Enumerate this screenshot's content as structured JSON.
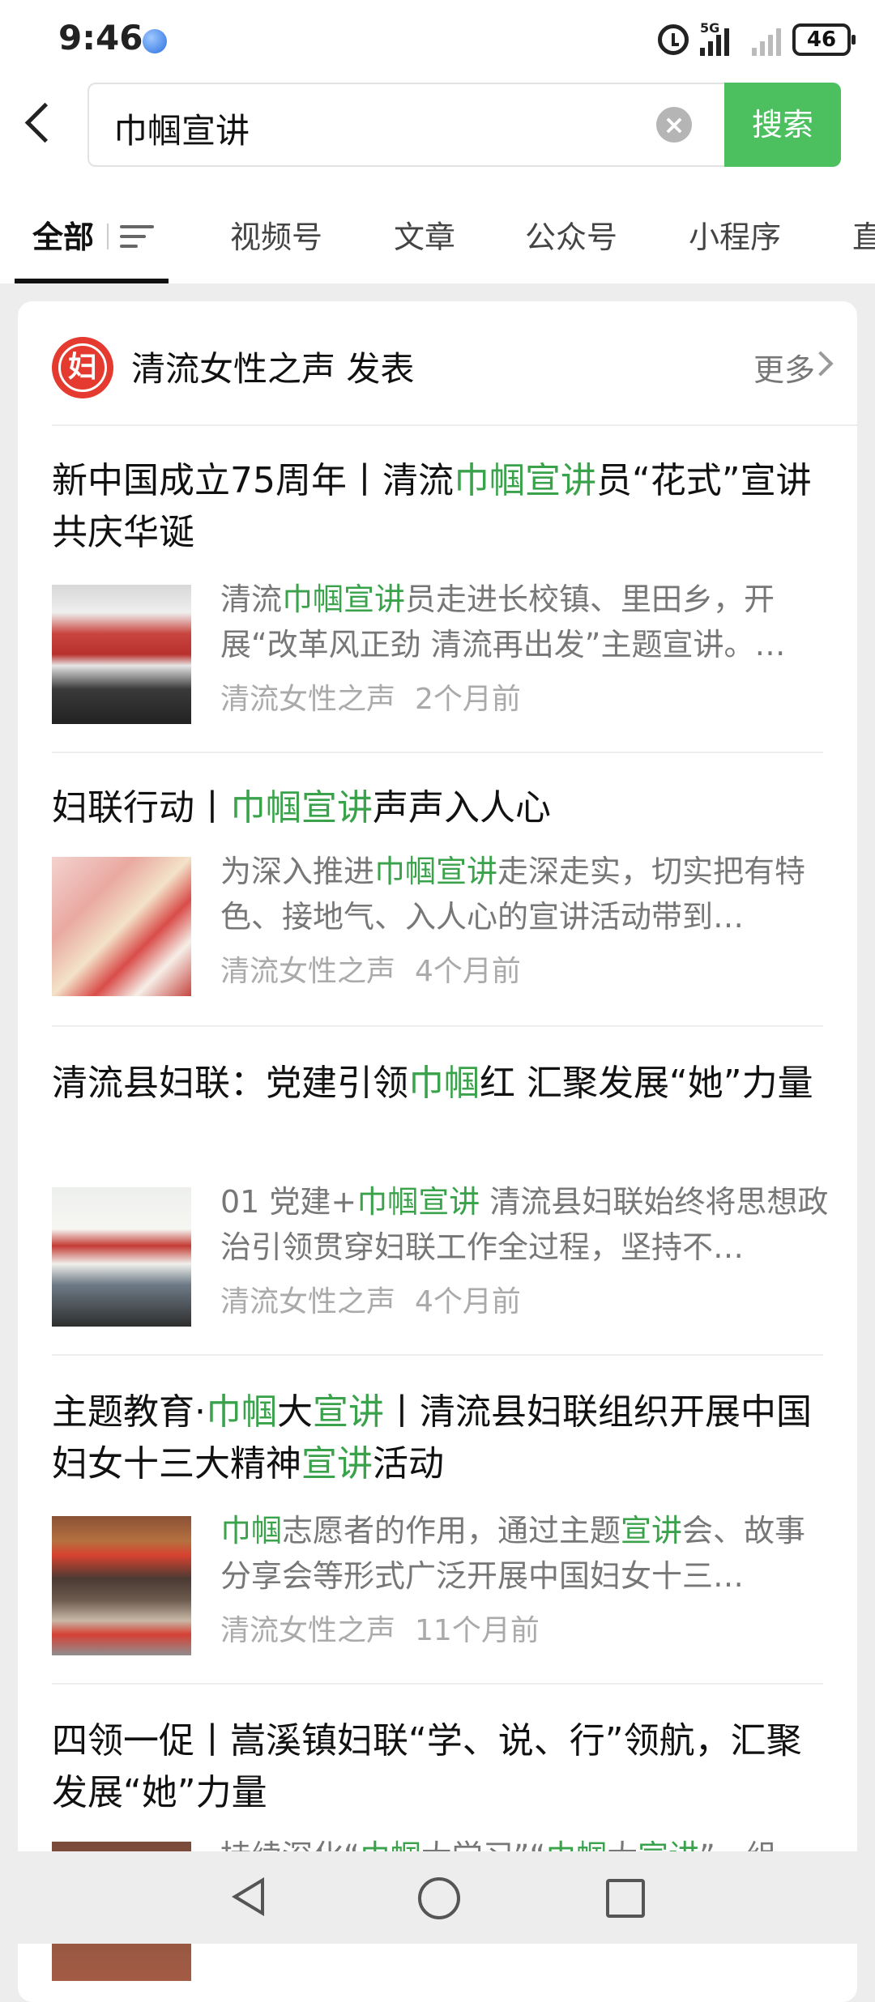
{
  "status_bar": {
    "time": "9:46",
    "network": "5G",
    "battery": "46"
  },
  "search": {
    "query": "巾帼宣讲",
    "button_label": "搜索"
  },
  "tabs": [
    {
      "label": "全部",
      "active": true
    },
    {
      "label": "视频号"
    },
    {
      "label": "文章"
    },
    {
      "label": "公众号"
    },
    {
      "label": "小程序"
    },
    {
      "label": "直"
    }
  ],
  "account": {
    "name": "清流女性之声 发表",
    "more_label": "更多"
  },
  "articles": [
    {
      "title_parts": [
        "新中国成立75周年丨清流",
        "巾帼宣讲",
        "员“花式”宣讲共庆华诞"
      ],
      "snippet_parts": [
        "清流",
        "巾帼宣讲",
        "员走进长校镇、里田乡，开展“改革风正劲 清流再出发”主题宣讲。…"
      ],
      "source": "清流女性之声",
      "time": "2个月前"
    },
    {
      "title_parts": [
        "妇联行动丨",
        "巾帼宣讲",
        "声声入人心"
      ],
      "snippet_parts": [
        "为深入推进",
        "巾帼宣讲",
        "走深走实，切实把有特色、接地气、入人心的宣讲活动带到…"
      ],
      "source": "清流女性之声",
      "time": "4个月前"
    },
    {
      "title_parts": [
        "清流县妇联：党建引领",
        "巾帼",
        "红 汇聚发展“她”力量"
      ],
      "snippet_parts": [
        "01 党建+",
        "巾帼宣讲",
        " 清流县妇联始终将思想政治引领贯穿妇联工作全过程，坚持不…"
      ],
      "source": "清流女性之声",
      "time": "4个月前"
    },
    {
      "title_parts": [
        "主题教育·",
        "巾帼",
        "大",
        "宣讲",
        "丨清流县妇联组织开展中国妇女十三大精神",
        "宣讲",
        "活动"
      ],
      "snippet_parts": [
        "巾帼",
        "志愿者的作用，通过主题",
        "宣讲",
        "会、故事分享会等形式广泛开展中国妇女十三…"
      ],
      "source": "清流女性之声",
      "time": "11个月前"
    },
    {
      "title_parts": [
        "四领一促丨嵩溪镇妇联“学、说、行”领航，汇聚发展“她”力量"
      ],
      "snippet_parts": [
        "持续深化“",
        "巾帼",
        "大学习”“",
        "巾帼",
        "大",
        "宣讲",
        "”，组"
      ]
    }
  ],
  "colors": {
    "accent": "#4cc05f",
    "highlight": "#3aa24b",
    "account_logo": "#e53a2f"
  }
}
